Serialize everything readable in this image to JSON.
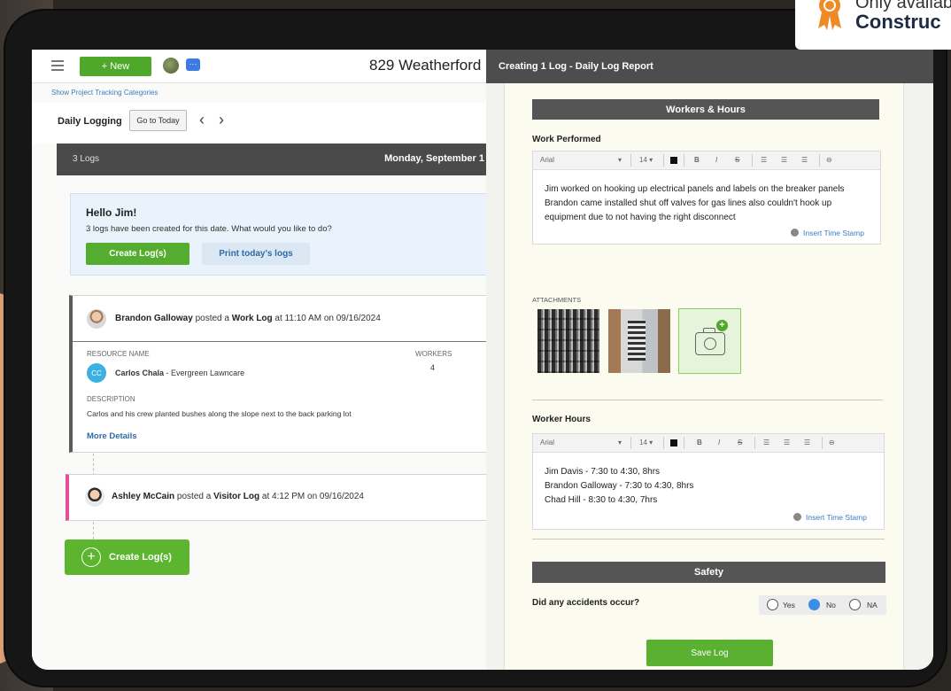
{
  "badge": {
    "line1": "Only availab",
    "line2": "Construc",
    "icon": "award-ribbon-icon"
  },
  "left_app": {
    "new_button": "+ New",
    "project_title": "829 Weatherford",
    "tracking_link": "Show Project Tracking Categories",
    "daily_logging": "Daily Logging",
    "go_to_today": "Go to Today",
    "log_count": "3 Logs",
    "date_header": "Monday, September 1",
    "hello": {
      "title": "Hello Jim!",
      "message": "3 logs have been created for this date. What would you like to do?",
      "create_button": "Create Log(s)",
      "print_button": "Print today's logs"
    },
    "work_log": {
      "poster": "Brandon Galloway",
      "posted_a": " posted a ",
      "log_type": "Work Log",
      "posted_at": " at 11:10 AM on 09/16/2024",
      "resource_label": "RESOURCE NAME",
      "workers_label": "WORKERS",
      "resource_initials": "CC",
      "resource_name": "Carlos Chala",
      "resource_company": " - Evergreen Lawncare",
      "workers_value": "4",
      "description_label": "DESCRIPTION",
      "description": "Carlos and his crew planted bushes along the slope next to the back parking lot",
      "more_details": "More Details"
    },
    "visitor_log": {
      "poster": "Ashley McCain",
      "posted_a": " posted a ",
      "log_type": "Visitor Log",
      "posted_at": " at 4:12 PM on 09/16/2024"
    },
    "create_big": "Create Log(s)"
  },
  "modal": {
    "title": "Creating 1 Log - Daily Log Report",
    "workers_hours_header": "Workers & Hours",
    "work_performed_label": "Work Performed",
    "toolbar": {
      "font": "Arial",
      "size": "14 ▾",
      "bold": "B",
      "italic": "I",
      "strike": "S"
    },
    "work_performed_text": [
      "Jim worked on hooking up electrical panels and labels on the breaker panels",
      "Brandon came installed shut off valves for gas lines also couldn't hook up",
      "equipment due to not having the right disconnect"
    ],
    "insert_time_stamp": "Insert Time Stamp",
    "attachments_label": "ATTACHMENTS",
    "worker_hours_label": "Worker Hours",
    "worker_hours_text": [
      "Jim Davis - 7:30 to 4:30, 8hrs",
      "Brandon Galloway - 7:30 to 4:30, 8hrs",
      "Chad Hill - 8:30 to 4:30, 7hrs"
    ],
    "safety_header": "Safety",
    "accidents_question": "Did any accidents occur?",
    "radio_options": [
      "Yes",
      "No",
      "NA"
    ],
    "selected_option": "No",
    "save_button": "Save Log"
  },
  "colors": {
    "brand_green": "#54ad2e",
    "link_blue": "#3b7dc4",
    "header_dark": "#4d4d4d",
    "visitor_pink": "#e64d9a"
  }
}
